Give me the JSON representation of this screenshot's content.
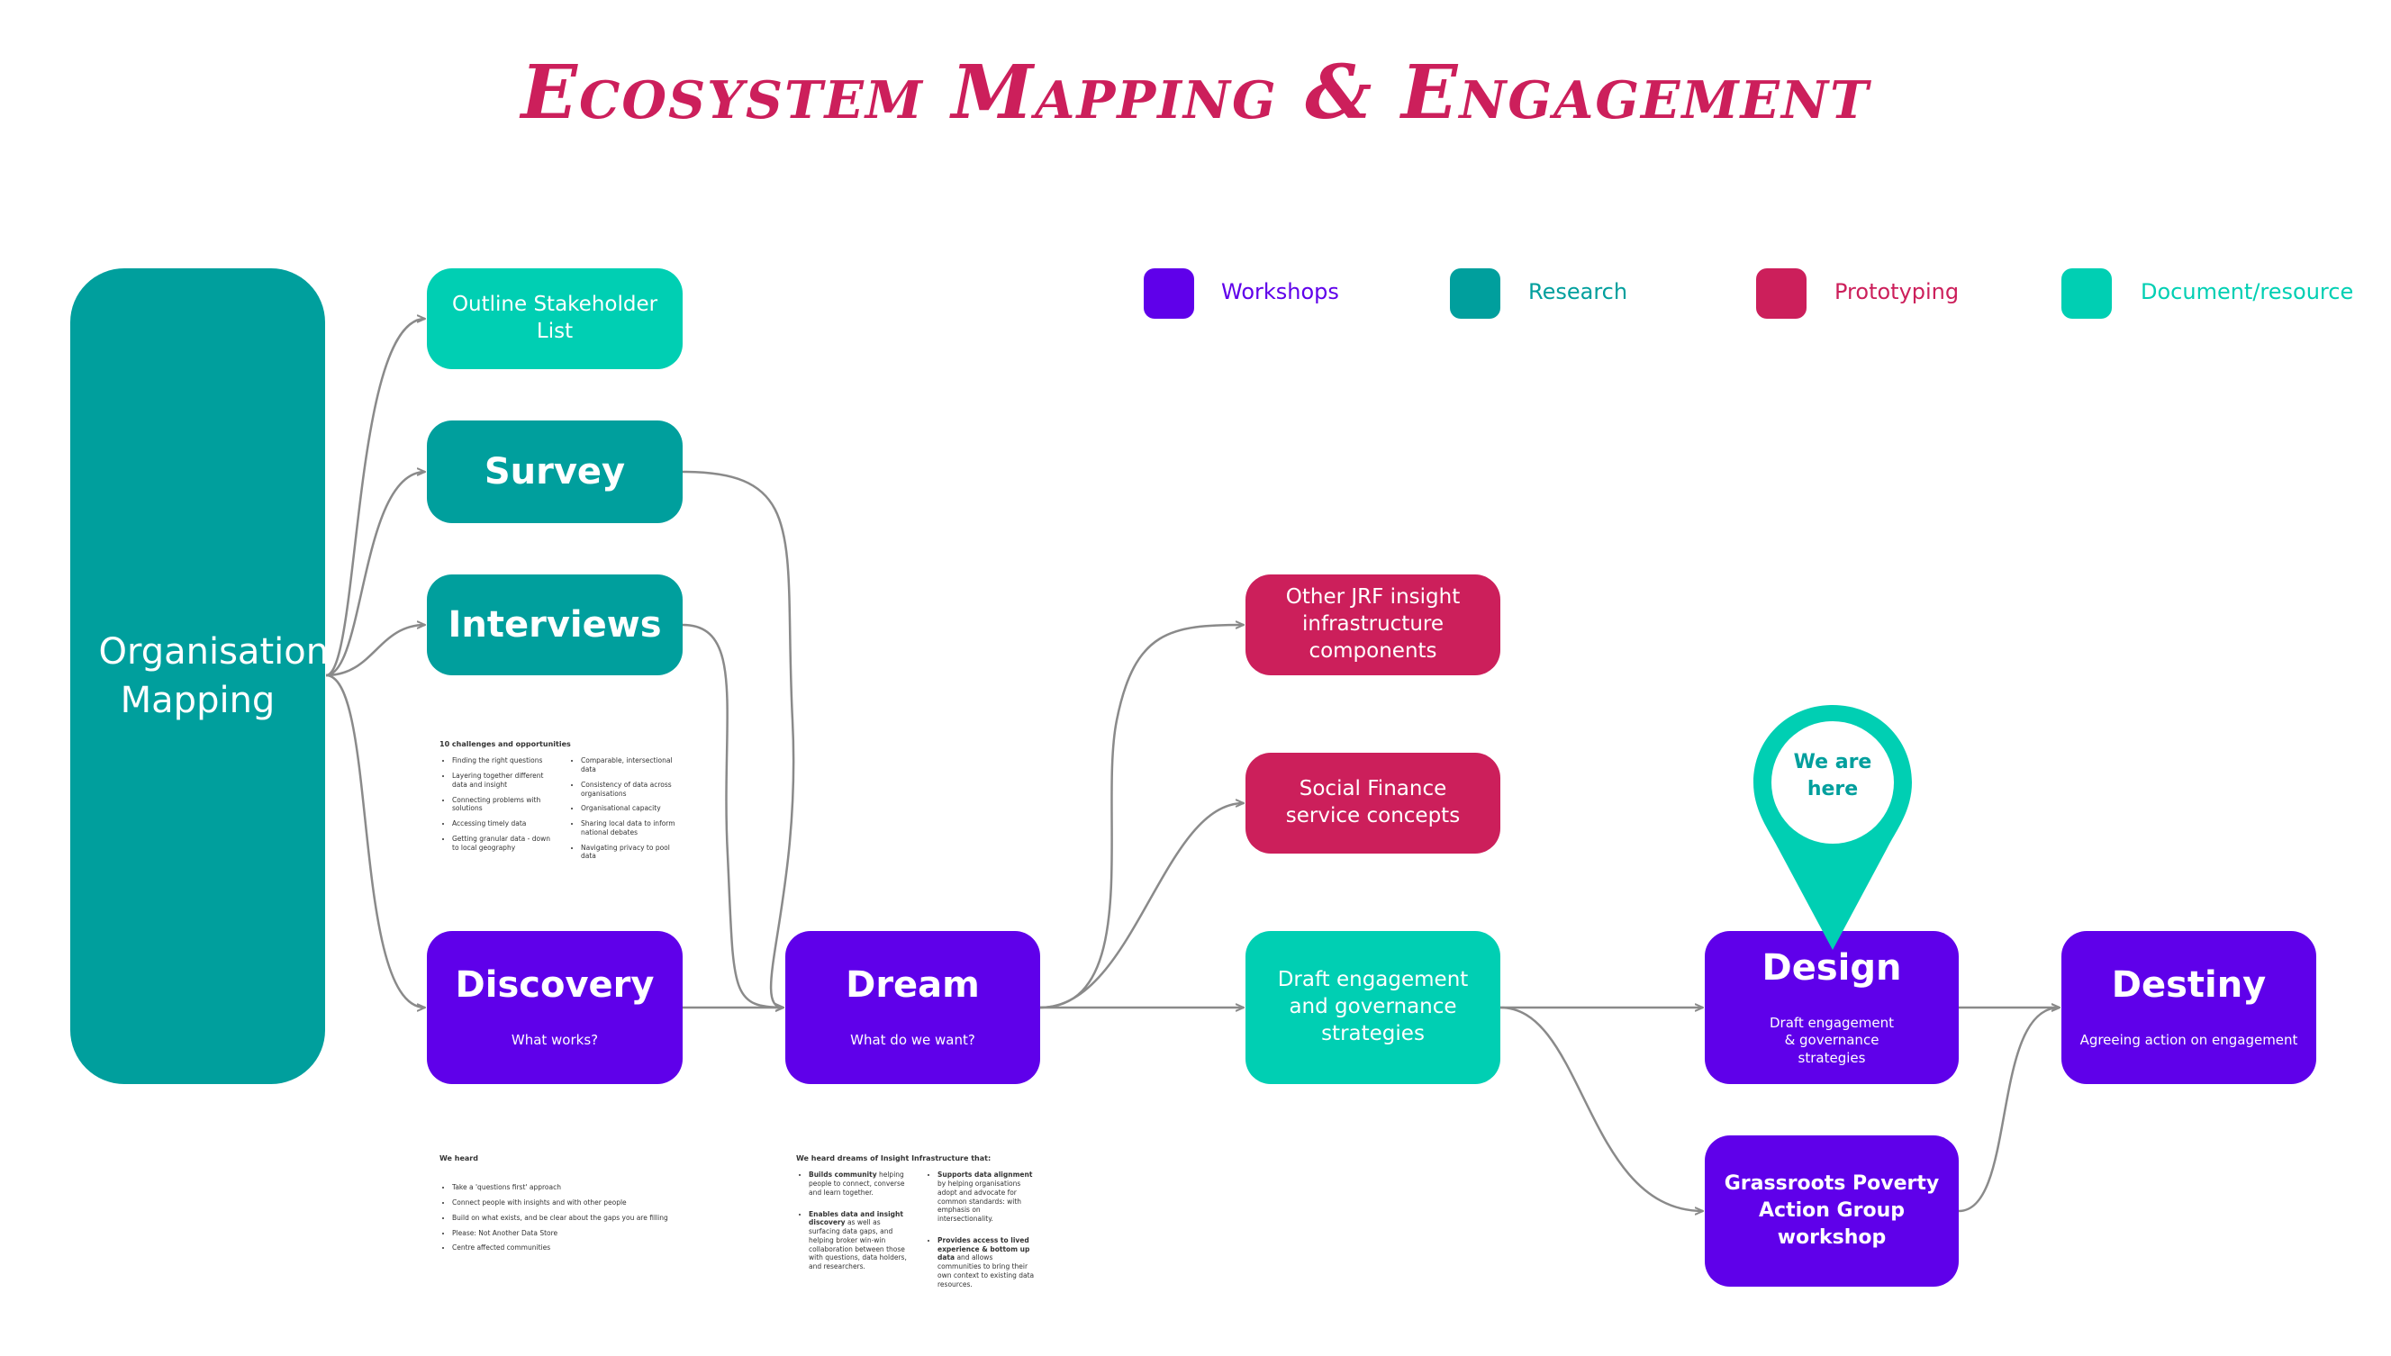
{
  "title": "Ecosystem Mapping & Engagement",
  "colors": {
    "workshops": "#5f00ea",
    "research": "#009f9d",
    "prototyping": "#cc1f5b",
    "document": "#00cfb3",
    "connector": "#8a8a8a",
    "title": "#cc1f5b"
  },
  "legend": [
    {
      "label": "Workshops",
      "color": "#5f00ea"
    },
    {
      "label": "Research",
      "color": "#009f9d"
    },
    {
      "label": "Prototyping",
      "color": "#cc1f5b"
    },
    {
      "label": "Document/resource",
      "color": "#00cfb3"
    }
  ],
  "nodes": {
    "org": {
      "label": "Organisation Mapping",
      "category": "Research"
    },
    "outline": {
      "label": "Outline Stakeholder List",
      "category": "Document/resource"
    },
    "survey": {
      "label": "Survey",
      "category": "Research"
    },
    "interviews": {
      "label": "Interviews",
      "category": "Research"
    },
    "discovery": {
      "label": "Discovery",
      "sub": "What works?",
      "category": "Workshops"
    },
    "dream": {
      "label": "Dream",
      "sub": "What do we want?",
      "category": "Workshops"
    },
    "other_jrf": {
      "label": "Other JRF insight infrastructure components",
      "category": "Prototyping"
    },
    "social_finance": {
      "label": "Social Finance service concepts",
      "category": "Prototyping"
    },
    "draft": {
      "label": "Draft engagement and governance strategies",
      "category": "Document/resource"
    },
    "design": {
      "label": "Design",
      "sub": "Draft engagement & governance strategies",
      "category": "Workshops"
    },
    "destiny": {
      "label": "Destiny",
      "sub": "Agreeing action on engagement",
      "category": "Workshops"
    },
    "grassroots": {
      "label": "Grassroots Poverty Action Group workshop",
      "category": "Workshops"
    }
  },
  "edges": [
    [
      "org",
      "outline"
    ],
    [
      "org",
      "survey"
    ],
    [
      "org",
      "interviews"
    ],
    [
      "org",
      "discovery"
    ],
    [
      "survey",
      "dream"
    ],
    [
      "interviews",
      "dream"
    ],
    [
      "discovery",
      "dream"
    ],
    [
      "dream",
      "other_jrf"
    ],
    [
      "dream",
      "social_finance"
    ],
    [
      "dream",
      "draft"
    ],
    [
      "draft",
      "design"
    ],
    [
      "draft",
      "grassroots"
    ],
    [
      "design",
      "destiny"
    ],
    [
      "grassroots",
      "destiny"
    ]
  ],
  "marker": {
    "label_line1": "We are",
    "label_line2": "here",
    "target": "design"
  },
  "challenges": {
    "heading": "10 challenges and opportunities",
    "left": [
      "Finding the right questions",
      "Layering together different data and insight",
      "Connecting problems with solutions",
      "Accessing timely data",
      "Getting granular data - down to local geography"
    ],
    "right": [
      "Comparable, intersectional data",
      "Consistency of data across organisations",
      "Organisational capacity",
      "Sharing local data to inform national debates",
      "Navigating privacy to pool data"
    ]
  },
  "we_heard": {
    "heading": "We heard",
    "items": [
      "Take a 'questions first' approach",
      "Connect people with insights and with other people",
      "Build on what exists, and be clear about the gaps you are filling",
      "Please: Not Another Data Store",
      "Centre affected communities"
    ]
  },
  "dreams": {
    "heading": "We heard dreams of Insight Infrastructure that:",
    "items": [
      {
        "bold": "Builds community",
        "rest": " helping people to connect, converse and learn together."
      },
      {
        "bold": "Supports data alignment",
        "rest": " by helping organisations adopt and advocate for common standards: with emphasis on intersectionality."
      },
      {
        "bold": "Enables data and insight discovery",
        "rest": " as well as surfacing data gaps, and helping broker win-win collaboration between those with questions, data holders, and researchers."
      },
      {
        "bold": "Provides access to lived experience & bottom up data",
        "rest": " and allows communities to bring their own context to existing data resources."
      }
    ]
  }
}
